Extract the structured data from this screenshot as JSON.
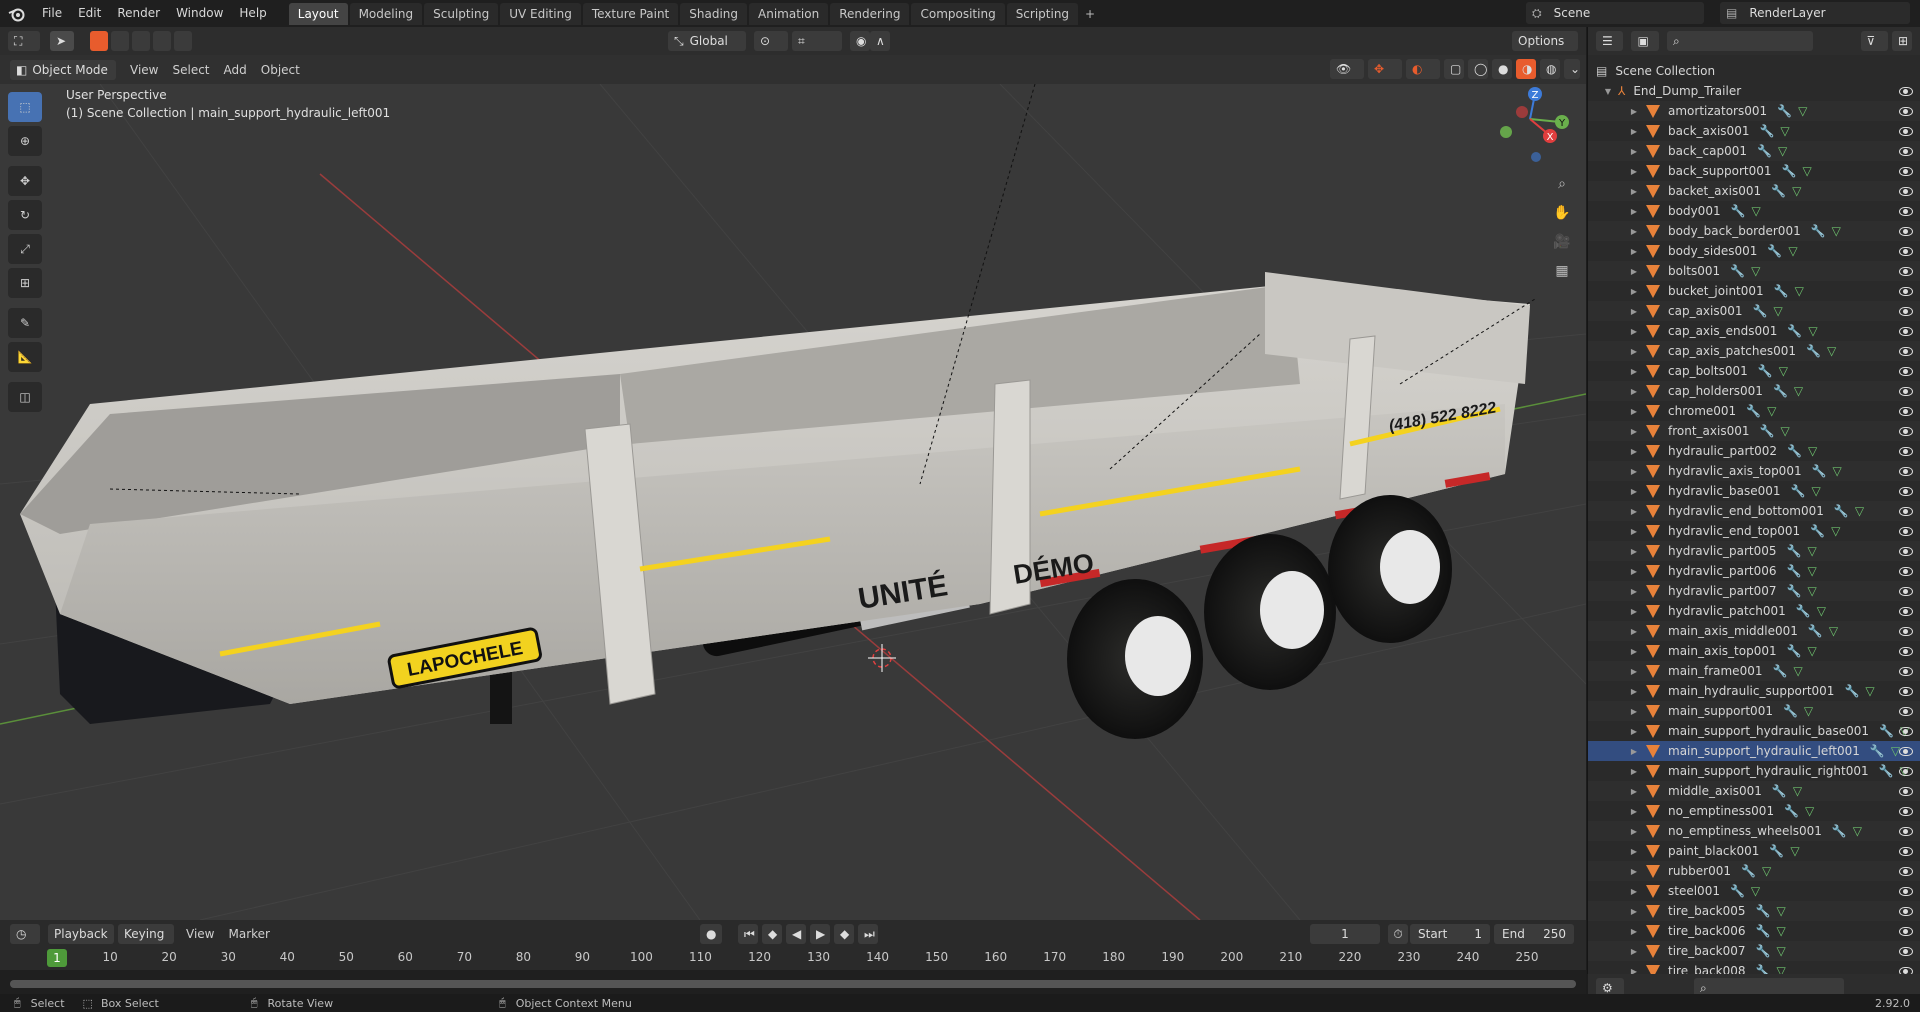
{
  "menu": [
    "File",
    "Edit",
    "Render",
    "Window",
    "Help"
  ],
  "workspaces": [
    "Layout",
    "Modeling",
    "Sculpting",
    "UV Editing",
    "Texture Paint",
    "Shading",
    "Animation",
    "Rendering",
    "Compositing",
    "Scripting"
  ],
  "scene": "Scene",
  "render_layer": "RenderLayer",
  "header": {
    "mode": "Object Mode",
    "view": "View",
    "select": "Select",
    "add": "Add",
    "object": "Object",
    "orientation": "Global",
    "options": "Options"
  },
  "viewport": {
    "perspective": "User Perspective",
    "context": "(1) Scene Collection | main_support_hydraulic_left001"
  },
  "model_text": {
    "brand": "LAPOCHELE",
    "unit": "UNITÉ",
    "demo": "DÉMO",
    "phone": "(418) 522 8222"
  },
  "gizmo": {
    "z": "Z",
    "y": "Y",
    "x": "X"
  },
  "outliner": {
    "root": "Scene Collection",
    "parent": "End_Dump_Trailer",
    "items": [
      "amortizators001",
      "back_axis001",
      "back_cap001",
      "back_support001",
      "backet_axis001",
      "body001",
      "body_back_border001",
      "body_sides001",
      "bolts001",
      "bucket_joint001",
      "cap_axis001",
      "cap_axis_ends001",
      "cap_axis_patches001",
      "cap_bolts001",
      "cap_holders001",
      "chrome001",
      "front_axis001",
      "hydraulic_part002",
      "hydravlic_axis_top001",
      "hydravlic_base001",
      "hydravlic_end_bottom001",
      "hydravlic_end_top001",
      "hydravlic_part005",
      "hydravlic_part006",
      "hydravlic_part007",
      "hydravlic_patch001",
      "main_axis_middle001",
      "main_axis_top001",
      "main_frame001",
      "main_hydraulic_support001",
      "main_support001",
      "main_support_hydraulic_base001",
      "main_support_hydraulic_left001",
      "main_support_hydraulic_right001",
      "middle_axis001",
      "no_emptiness001",
      "no_emptiness_wheels001",
      "paint_black001",
      "rubber001",
      "steel001",
      "tire_back005",
      "tire_back006",
      "tire_back007",
      "tire_back008"
    ],
    "selected_index": 32
  },
  "timeline": {
    "playback": "Playback",
    "keying": "Keying",
    "view": "View",
    "marker": "Marker",
    "current_frame": "1",
    "start_label": "Start",
    "start": "1",
    "end_label": "End",
    "end": "250",
    "ticks": [
      "1",
      "10",
      "20",
      "30",
      "40",
      "50",
      "60",
      "70",
      "80",
      "90",
      "100",
      "110",
      "120",
      "130",
      "140",
      "150",
      "160",
      "170",
      "180",
      "190",
      "200",
      "210",
      "220",
      "230",
      "240",
      "250"
    ]
  },
  "status": {
    "select": "Select",
    "box_select": "Box Select",
    "rotate": "Rotate View",
    "context": "Object Context Menu",
    "version": "2.92.0"
  },
  "colors": {
    "accent": "#4772b3",
    "object_icon": "#e8823a",
    "frame": "#4e9a3a",
    "selected_row": "#334d80"
  }
}
